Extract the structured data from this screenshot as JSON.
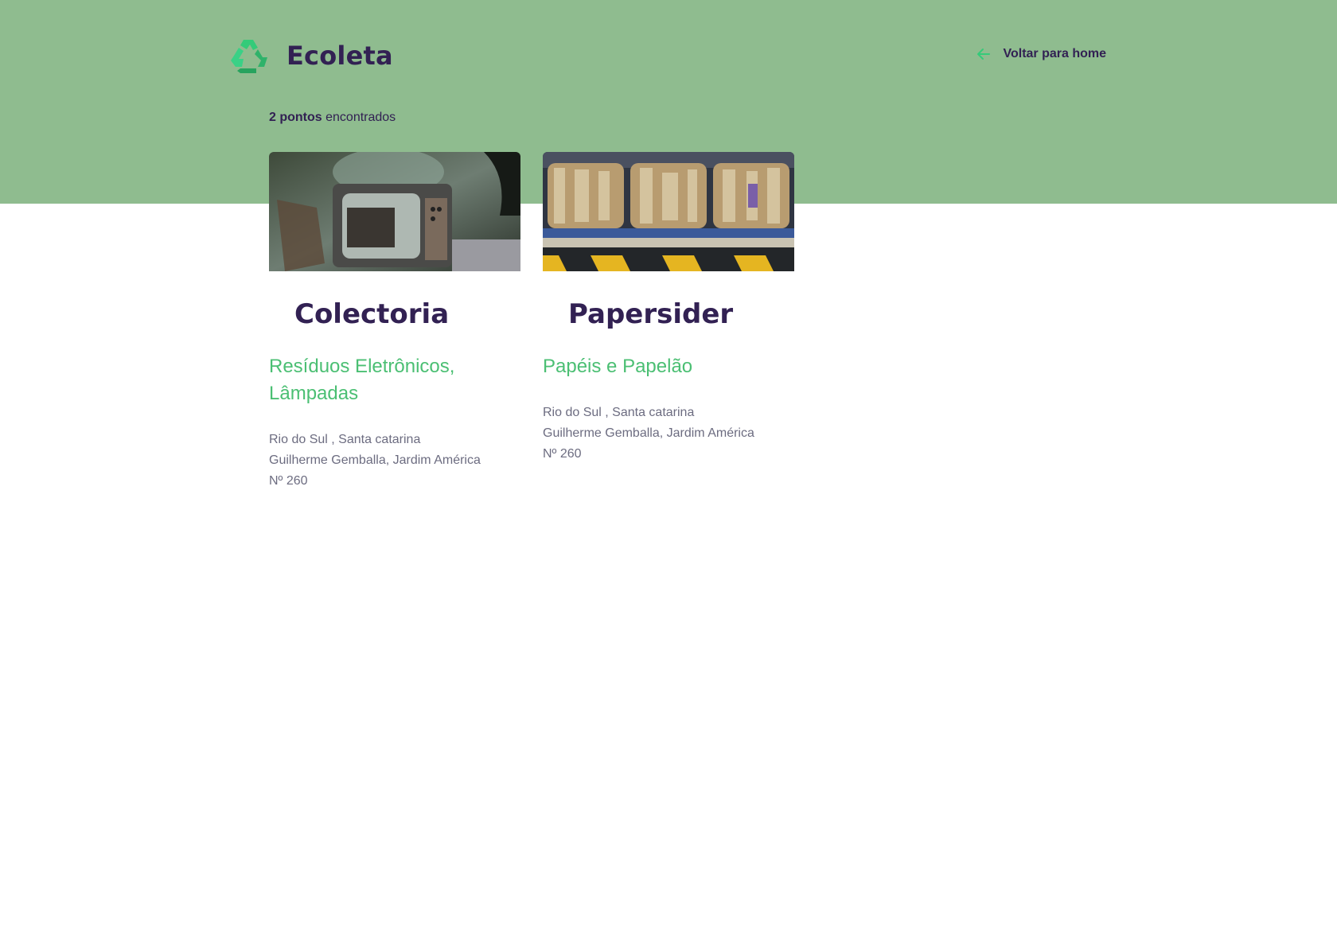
{
  "header": {
    "logo_text": "Ecoleta",
    "logo_icon": "recycle-icon",
    "back_label": "Voltar para home",
    "back_icon": "arrow-left-icon"
  },
  "results": {
    "count_strong": "2 pontos",
    "count_rest": " encontrados"
  },
  "points": [
    {
      "name": "Colectoria",
      "image": "old-tv-photo",
      "items": "Resíduos Eletrônicos, Lâmpadas",
      "city_line": "Rio do Sul , Santa catarina",
      "street_line": "Guilherme Gemballa, Jardim América",
      "number_line": "Nº 260"
    },
    {
      "name": "Papersider",
      "image": "cardboard-bales-photo",
      "items": "Papéis e Papelão",
      "city_line": "Rio do Sul , Santa catarina",
      "street_line": "Guilherme Gemballa, Jardim América",
      "number_line": "Nº 260"
    }
  ],
  "colors": {
    "hero_bg": "#8fbc8f",
    "title": "#322153",
    "accent_green": "#4bbf73",
    "text_muted": "#6c6c80"
  }
}
